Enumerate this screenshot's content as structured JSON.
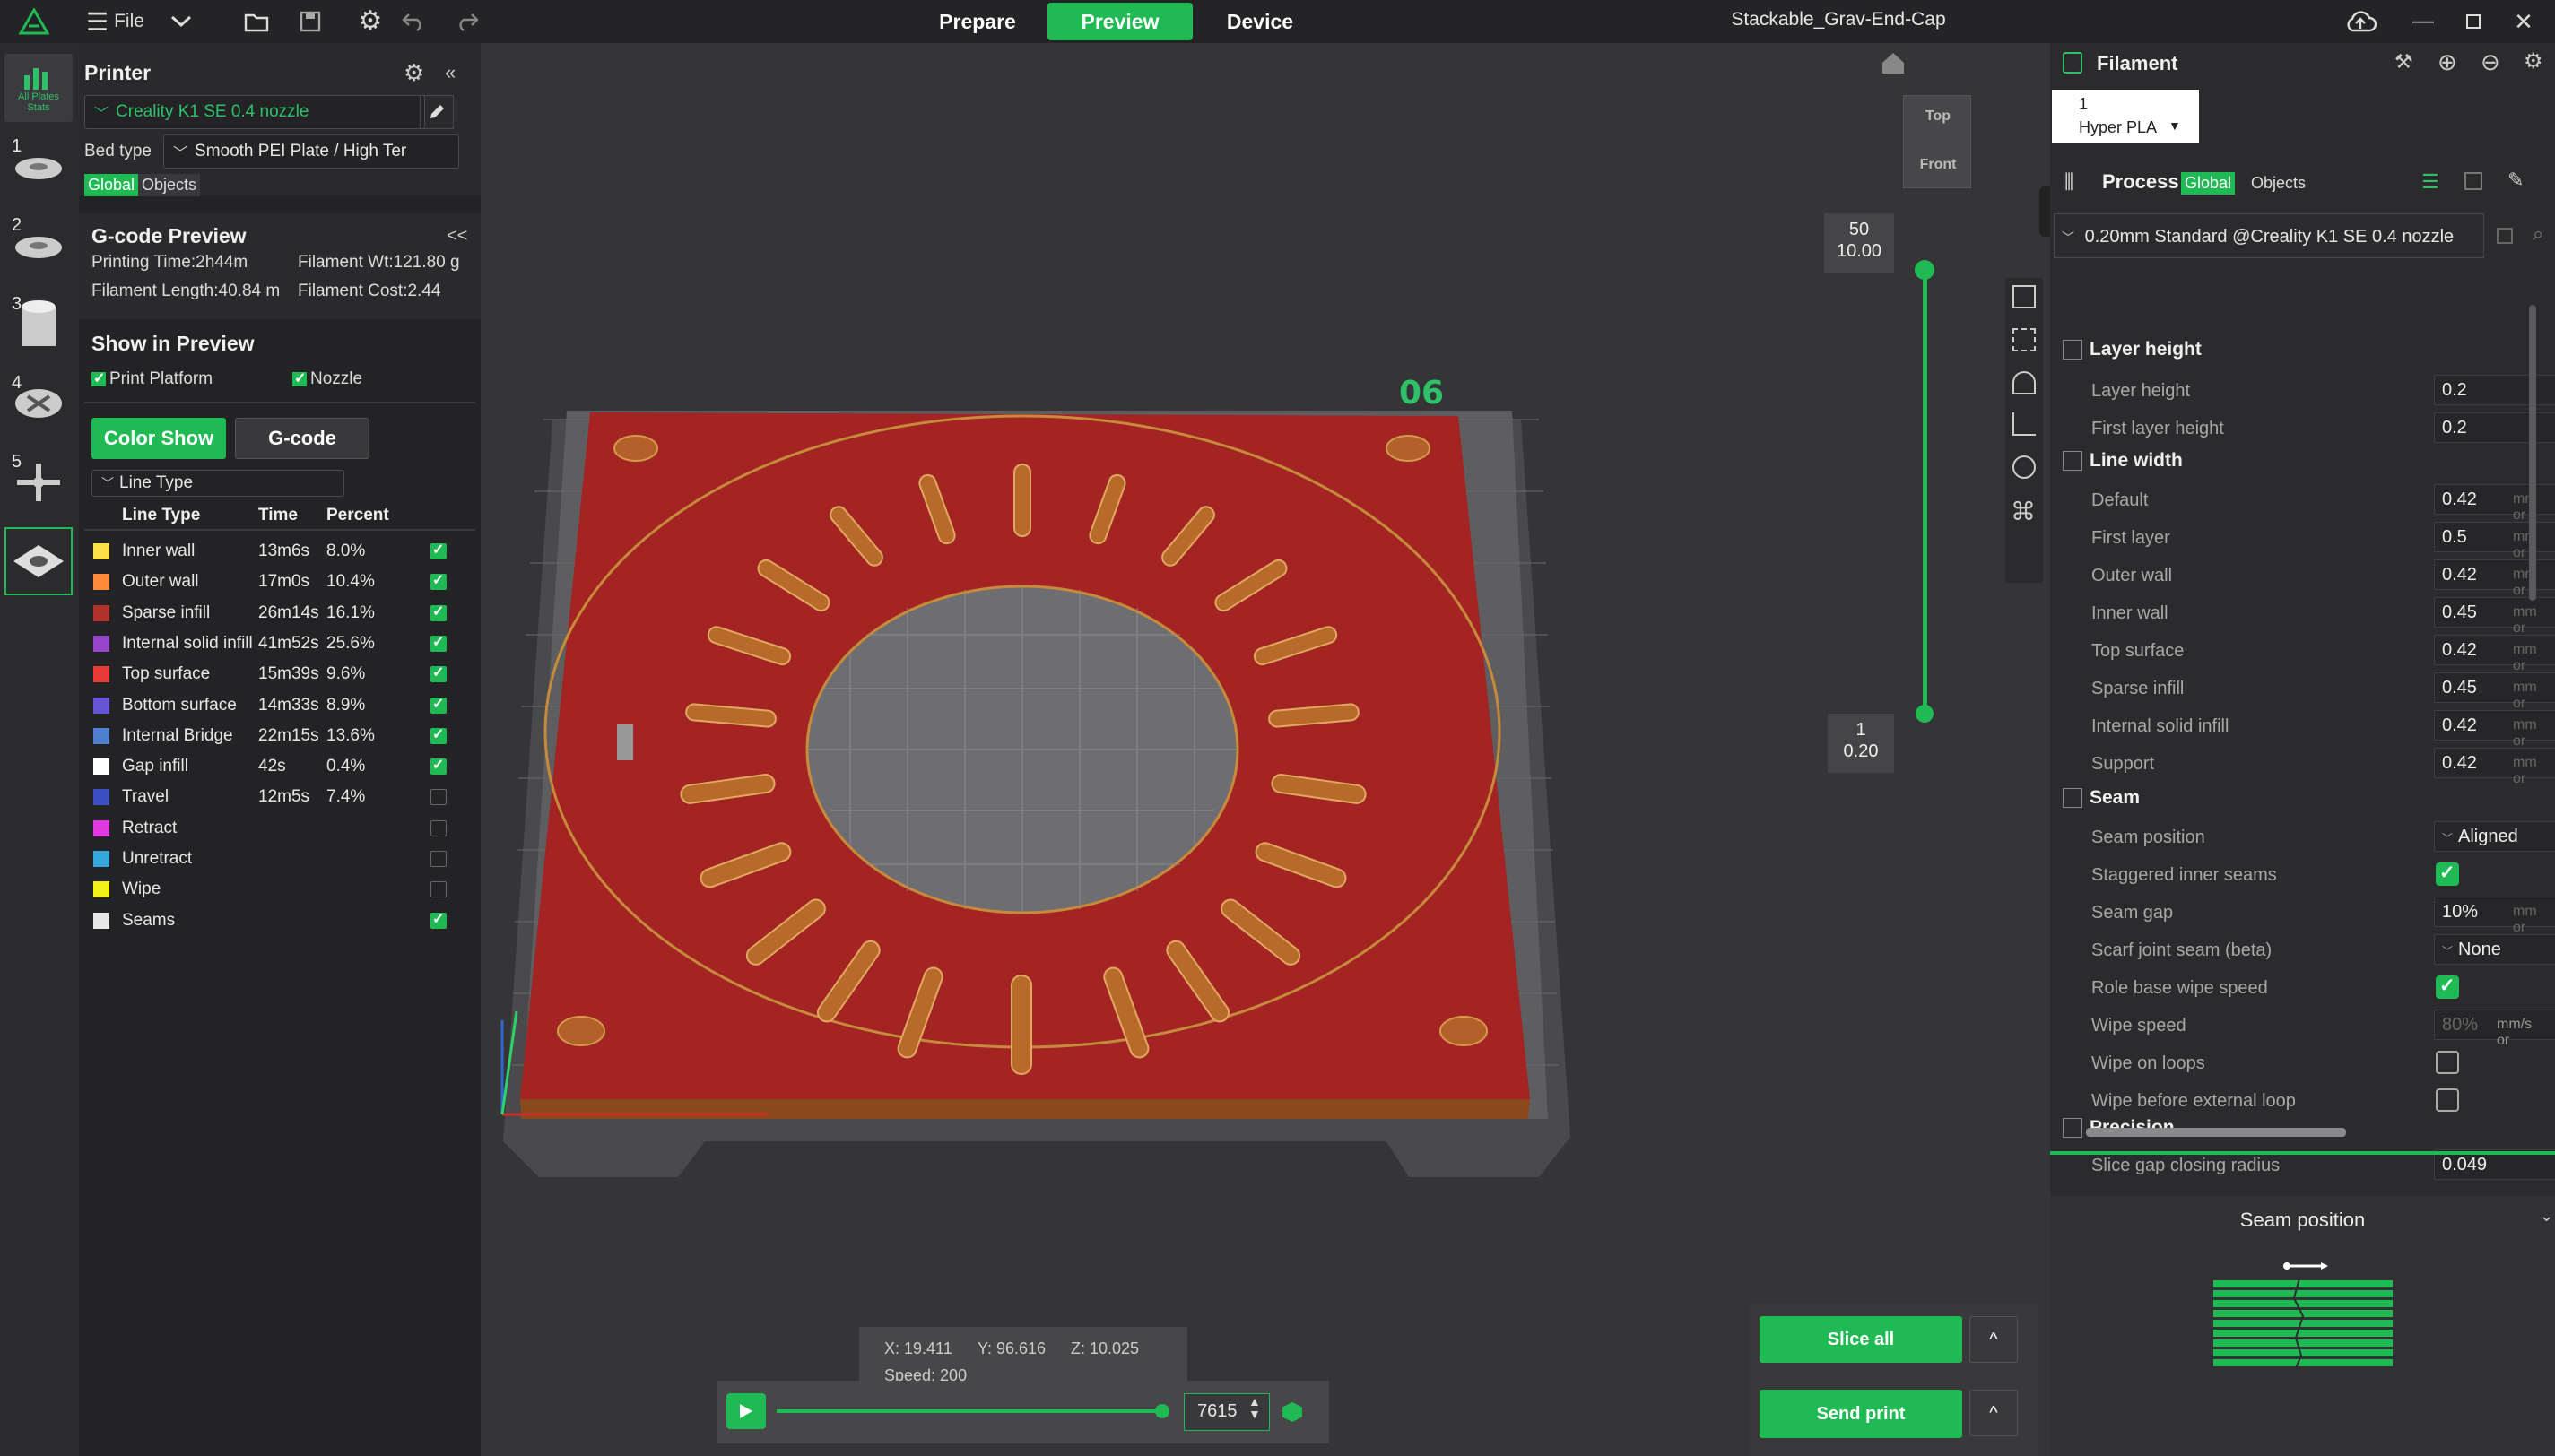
{
  "topbar": {
    "file_label": "File",
    "tabs": [
      {
        "label": "Prepare"
      },
      {
        "label": "Preview"
      },
      {
        "label": "Device"
      }
    ],
    "doc_title": "Stackable_Grav-End-Cap"
  },
  "leftstrip": {
    "all_plates_label": "All Plates Stats",
    "plate_numbers": [
      "1",
      "2",
      "3",
      "4",
      "5",
      "6"
    ]
  },
  "printer": {
    "title": "Printer",
    "profile": "Creality K1 SE 0.4 nozzle",
    "bed_type_label": "Bed type",
    "bed_type_value": "Smooth PEI Plate / High Ter",
    "scope_global": "Global",
    "scope_objects": "Objects"
  },
  "gcode_preview": {
    "title": "G-code Preview",
    "collapse": "<<",
    "printing_time": "Printing Time:2h44m",
    "filament_wt": "Filament Wt:121.80 g",
    "filament_length": "Filament Length:40.84 m",
    "filament_cost": "Filament Cost:2.44"
  },
  "show_in_preview": {
    "title": "Show in Preview",
    "print_platform": "Print Platform",
    "nozzle": "Nozzle",
    "color_show_btn": "Color Show",
    "gcode_btn": "G-code",
    "line_type_dropdown": "Line Type",
    "headers": {
      "line_type": "Line Type",
      "time": "Time",
      "percent": "Percent"
    },
    "rows": [
      {
        "name": "Inner wall",
        "time": "13m6s",
        "percent": "8.0%",
        "color": "#ffe04a",
        "checked": true
      },
      {
        "name": "Outer wall",
        "time": "17m0s",
        "percent": "10.4%",
        "color": "#ff8a3a",
        "checked": true
      },
      {
        "name": "Sparse infill",
        "time": "26m14s",
        "percent": "16.1%",
        "color": "#b0322c",
        "checked": true
      },
      {
        "name": "Internal solid infill",
        "time": "41m52s",
        "percent": "25.6%",
        "color": "#9546c8",
        "checked": true
      },
      {
        "name": "Top surface",
        "time": "15m39s",
        "percent": "9.6%",
        "color": "#e83a3a",
        "checked": true
      },
      {
        "name": "Bottom surface",
        "time": "14m33s",
        "percent": "8.9%",
        "color": "#6655d4",
        "checked": true
      },
      {
        "name": "Internal Bridge",
        "time": "22m15s",
        "percent": "13.6%",
        "color": "#4f7fd0",
        "checked": true
      },
      {
        "name": "Gap infill",
        "time": "42s",
        "percent": "0.4%",
        "color": "#ffffff",
        "checked": true
      },
      {
        "name": "Travel",
        "time": "12m5s",
        "percent": "7.4%",
        "color": "#3b4fc4",
        "checked": false
      },
      {
        "name": "Retract",
        "time": "",
        "percent": "",
        "color": "#e03ae0",
        "checked": false
      },
      {
        "name": "Unretract",
        "time": "",
        "percent": "",
        "color": "#35a8d8",
        "checked": false
      },
      {
        "name": "Wipe",
        "time": "",
        "percent": "",
        "color": "#f2f21a",
        "checked": false
      },
      {
        "name": "Seams",
        "time": "",
        "percent": "",
        "color": "#e6e6e6",
        "checked": true
      }
    ]
  },
  "viewport": {
    "plate_label": "06",
    "view_cube_top": "Top",
    "view_cube_front": "Front",
    "layer_top_num": "50",
    "layer_top_height": "10.00",
    "layer_bottom_num": "1",
    "layer_bottom_height": "0.20",
    "coords_x": "X: 19.411",
    "coords_y": "Y: 96.616",
    "coords_z": "Z: 10.025",
    "speed": "Speed: 200",
    "move_value": "7615",
    "slice_all": "Slice all",
    "send_print": "Send print",
    "caret": "^"
  },
  "filament": {
    "title": "Filament",
    "slot_number": "1",
    "slot_name": "Hyper PLA"
  },
  "process": {
    "title": "Process",
    "scope_global": "Global",
    "scope_objects": "Objects",
    "profile": "0.20mm Standard @Creality K1 SE 0.4 nozzle",
    "groups": {
      "layer_height": "Layer height",
      "line_width": "Line width",
      "seam": "Seam",
      "precision": "Precision"
    },
    "layer_height_rows": [
      {
        "label": "Layer height",
        "value": "0.2",
        "unit": "m"
      },
      {
        "label": "First layer height",
        "value": "0.2",
        "unit": "m"
      }
    ],
    "line_width_rows": [
      {
        "label": "Default",
        "value": "0.42",
        "unit": "mm or"
      },
      {
        "label": "First layer",
        "value": "0.5",
        "unit": "mm or"
      },
      {
        "label": "Outer wall",
        "value": "0.42",
        "unit": "mm or"
      },
      {
        "label": "Inner wall",
        "value": "0.45",
        "unit": "mm or"
      },
      {
        "label": "Top surface",
        "value": "0.42",
        "unit": "mm or"
      },
      {
        "label": "Sparse infill",
        "value": "0.45",
        "unit": "mm or"
      },
      {
        "label": "Internal solid infill",
        "value": "0.42",
        "unit": "mm or"
      },
      {
        "label": "Support",
        "value": "0.42",
        "unit": "mm or"
      }
    ],
    "seam": {
      "seam_position_label": "Seam position",
      "seam_position_value": "Aligned",
      "staggered_label": "Staggered inner seams",
      "seam_gap_label": "Seam gap",
      "seam_gap_value": "10%",
      "seam_gap_unit": "mm or",
      "scarf_label": "Scarf joint seam (beta)",
      "scarf_value": "None",
      "role_wipe_label": "Role base wipe speed",
      "wipe_speed_label": "Wipe speed",
      "wipe_speed_value": "80%",
      "wipe_speed_unit": "mm/s or",
      "wipe_loops_label": "Wipe on loops",
      "wipe_before_label": "Wipe before external loop"
    },
    "precision_partial": "Slice gap closing radius",
    "precision_partial_value": "0.049"
  },
  "help_panel": {
    "title": "Seam position"
  }
}
